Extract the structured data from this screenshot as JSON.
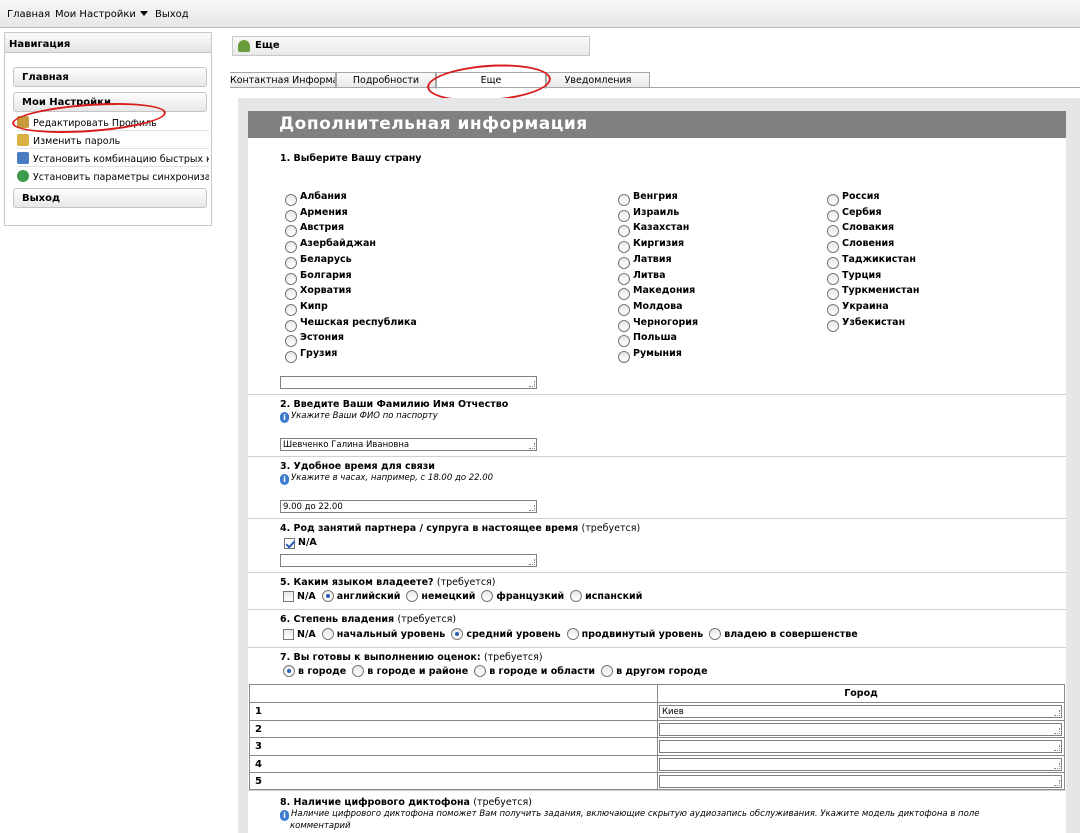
{
  "menubar": {
    "home": "Главная",
    "settings": "Мои Настройки",
    "logout": "Выход"
  },
  "nav": {
    "header": "Навигация",
    "home_button": "Главная",
    "settings_button": "Мои Настройки",
    "links": [
      {
        "label": "Редактировать Профиль",
        "icon": "pencil-icon"
      },
      {
        "label": "Изменить пароль",
        "icon": "key-icon"
      },
      {
        "label": "Установить комбинацию быстрых к",
        "icon": "keyboard-icon"
      },
      {
        "label": "Установить параметры синхрониза",
        "icon": "sync-icon"
      }
    ],
    "logout_button": "Выход"
  },
  "page": {
    "title": "Еще"
  },
  "tabs": [
    "Контактная Информа",
    "Подробности",
    "Еще",
    "Уведомления"
  ],
  "section": {
    "header": "Дополнительная информация"
  },
  "q1": {
    "title": "1. Выберите Вашу страну",
    "col1": [
      "Албания",
      "Армения",
      "Австрия",
      "Азербайджан",
      "Беларусь",
      "Болгария",
      "Хорватия",
      "Кипр",
      "Чешская республика",
      "Эстония",
      "Грузия"
    ],
    "col2": [
      "Венгрия",
      "Израиль",
      "Казахстан",
      "Киргизия",
      "Латвия",
      "Литва",
      "Македония",
      "Молдова",
      "Черногория",
      "Польша",
      "Румыния"
    ],
    "col3": [
      "Россия",
      "Сербия",
      "Словакия",
      "Словения",
      "Таджикистан",
      "Турция",
      "Туркменистан",
      "Украина",
      "Узбекистан"
    ],
    "other_value": ""
  },
  "q2": {
    "title": "2. Введите Ваши Фамилию Имя Отчество",
    "hint": "Укажите Ваши ФИО по паспорту",
    "value": "Шевченко Галина Ивановна"
  },
  "q3": {
    "title": "3. Удобное время для связи",
    "hint": "Укажите в часах, например, с 18.00 до 22.00",
    "value": "9.00 до 22.00"
  },
  "q4": {
    "title": "4. Род занятий партнера / супруга в настоящее время",
    "required": "(требуется)",
    "na_label": "N/A",
    "na_checked": true,
    "value": ""
  },
  "q5": {
    "title": "5. Каким языком владеете?",
    "required": "(требуется)",
    "na_label": "N/A",
    "options": [
      "английский",
      "немецкий",
      "французкий",
      "испанский"
    ],
    "selected": "английский"
  },
  "q6": {
    "title": "6. Степень владения",
    "required": "(требуется)",
    "na_label": "N/A",
    "options": [
      "начальный уровень",
      "средний уровень",
      "продвинутый уровень",
      "владею в совершенстве"
    ],
    "selected": "средний уровень"
  },
  "q7": {
    "title": "7. Вы готовы к выполнению оценок:",
    "required": "(требуется)",
    "options": [
      "в городе",
      "в городе и районе",
      "в городе и области",
      "в другом городе"
    ],
    "selected": "в городе",
    "table": {
      "col_header": "Город",
      "rows": [
        {
          "n": "1",
          "city": "Киев"
        },
        {
          "n": "2",
          "city": ""
        },
        {
          "n": "3",
          "city": ""
        },
        {
          "n": "4",
          "city": ""
        },
        {
          "n": "5",
          "city": ""
        }
      ]
    }
  },
  "q8": {
    "title": "8. Наличие цифрового диктофона",
    "required": "(требуется)",
    "hint_line1": "Наличие цифрового диктофона поможет Вам получить задания, включающие скрытую аудиозапись обслуживания. Укажите модель диктофона в поле",
    "hint_line2": "комментарий"
  },
  "colors": {
    "header_bg": "#808080",
    "annotation": "#d81c1c",
    "radio_on": "#2c5fb3"
  }
}
